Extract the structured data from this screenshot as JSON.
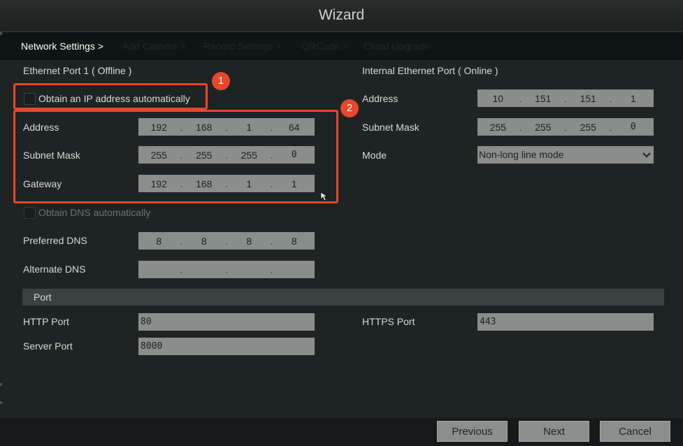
{
  "window": {
    "title": "Wizard"
  },
  "tabs": [
    {
      "label": "Network Settings >",
      "active": true
    },
    {
      "label": "Add Camera >",
      "active": false
    },
    {
      "label": "Record Settings >",
      "active": false
    },
    {
      "label": "QRCode >",
      "active": false
    },
    {
      "label": "Cloud Upgrade",
      "active": false
    }
  ],
  "ethernet1": {
    "heading": "Ethernet Port 1 ( Offline )",
    "obtain_ip_label": "Obtain an IP address automatically",
    "obtain_ip_checked": false,
    "address_label": "Address",
    "address": [
      "192",
      "168",
      "1",
      "64"
    ],
    "subnet_label": "Subnet Mask",
    "subnet": [
      "255",
      "255",
      "255",
      "0"
    ],
    "gateway_label": "Gateway",
    "gateway": [
      "192",
      "168",
      "1",
      "1"
    ],
    "obtain_dns_label": "Obtain DNS automatically",
    "obtain_dns_checked": false,
    "preferred_dns_label": "Preferred DNS",
    "preferred_dns": [
      "8",
      "8",
      "8",
      "8"
    ],
    "alternate_dns_label": "Alternate DNS",
    "alternate_dns": [
      "",
      "",
      "",
      ""
    ]
  },
  "internal": {
    "heading": "Internal Ethernet Port ( Online )",
    "address_label": "Address",
    "address": [
      "10",
      "151",
      "151",
      "1"
    ],
    "subnet_label": "Subnet Mask",
    "subnet": [
      "255",
      "255",
      "255",
      "0"
    ],
    "mode_label": "Mode",
    "mode_value": "Non-long line mode"
  },
  "port": {
    "section_title": "Port",
    "http_label": "HTTP Port",
    "http_value": "80",
    "https_label": "HTTPS Port",
    "https_value": "443",
    "server_label": "Server Port",
    "server_value": "8000"
  },
  "footer": {
    "previous_label": "Previous",
    "next_label": "Next",
    "cancel_label": "Cancel"
  },
  "annotations": {
    "badge1": "1",
    "badge2": "2"
  },
  "colors": {
    "highlight": "#e7472d",
    "field_bg": "#8a8d8b",
    "panel_bg": "#1e2424"
  },
  "icons": {
    "cursor": "mouse-pointer-icon",
    "dropdown": "chevron-down-icon"
  }
}
